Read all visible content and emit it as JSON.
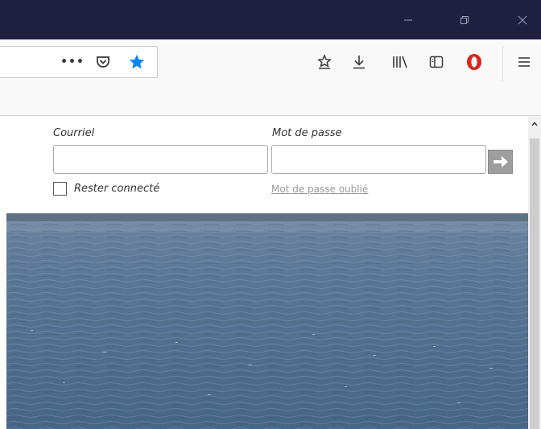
{
  "titlebar": {
    "controls": [
      "minimize-icon",
      "restore-icon",
      "close-icon"
    ]
  },
  "toolbar": {
    "urlbar_icons": [
      "more-actions-icon",
      "pocket-icon",
      "bookmark-star-icon"
    ],
    "page_actions_label": "•••",
    "bookmark_star_color": "#0a84ff",
    "right_icons": [
      "bookmarks-menu-icon",
      "downloads-icon",
      "library-icon",
      "sidebar-icon",
      "opera-icon",
      "hamburger-menu-icon"
    ],
    "opera_color": "#e2231a"
  },
  "login": {
    "email_label": "Courriel",
    "email_value": "",
    "password_label": "Mot de passe",
    "password_value": "",
    "remember_label": "Rester connecté",
    "remember_checked": false,
    "forgot_label": "Mot de passe oublié",
    "submit_icon": "arrow-right-icon"
  },
  "hero": {
    "image": "lake-water-photo",
    "water_color": "#4f6d8e",
    "horizon_color": "#5a6f7f"
  },
  "scrollbar": {
    "up_icon": "chevron-up-icon"
  }
}
